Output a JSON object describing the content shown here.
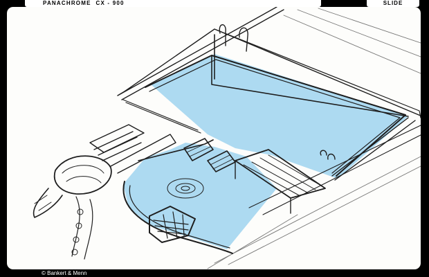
{
  "slide_frame": {
    "film_label": "PANACHROME  CX - 900",
    "slide_label": "SLIDE",
    "credit": "© Bankert & Menn"
  },
  "sketch": {
    "subject": "pool-sketch-icon",
    "colors": {
      "frame": "#000000",
      "paper": "#fdfdfb",
      "pencil": "#1e1e1e",
      "water": "#9fd3ee"
    }
  }
}
